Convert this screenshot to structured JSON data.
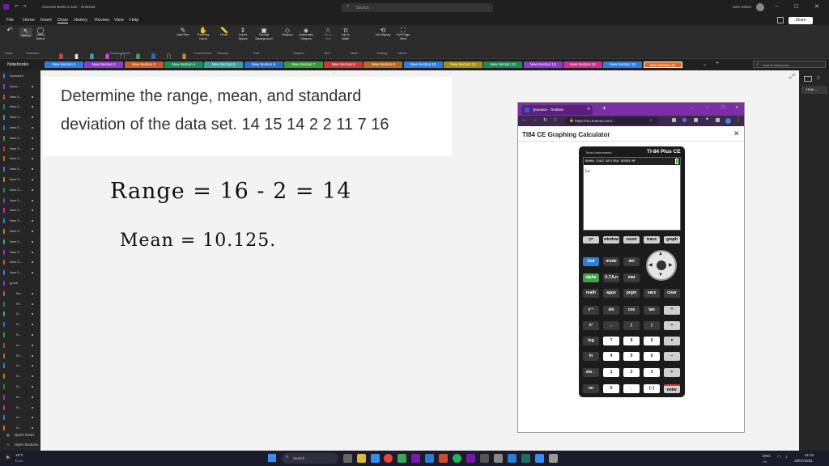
{
  "titlebar": {
    "title": "Onenote Berlin 6 Jahr - OneNote",
    "search_placeholder": "Search",
    "user": "Sam Kitson",
    "share": "Share"
  },
  "menu": [
    "File",
    "Home",
    "Insert",
    "Draw",
    "History",
    "Review",
    "View",
    "Help"
  ],
  "ribbon": {
    "undo": "Undo",
    "select": "Select",
    "lasso": "Lasso Select",
    "add_pen": "Add Pen",
    "panning": "Panning Hand",
    "ruler": "Ruler",
    "insert_space": "Insert Space",
    "format_bg": "Format Background",
    "shapes": "Shapes",
    "auto_shapes": "Automatic Shapes",
    "ink_to_text": "Ink to Text",
    "ink_to_math": "Ink to Math",
    "ink_replay": "Ink Replay",
    "full_page": "Full Page View",
    "groups": [
      "Undo",
      "Selection",
      "Drawing Tools",
      "Insert Mode",
      "Stencils",
      "Edit",
      "Shapes",
      "Text",
      "Math",
      "Replay",
      "Mode"
    ]
  },
  "pens": [
    "#d33",
    "#e6e6e6",
    "#3ad",
    "#e3e",
    "#222",
    "#3b3",
    "#26c",
    "#333",
    "#e80"
  ],
  "section_tabs": [
    {
      "label": "New Section 1",
      "color": "#2f7de1"
    },
    {
      "label": "New Section 2",
      "color": "#8a3dc9"
    },
    {
      "label": "New Section 3",
      "color": "#c75b2a"
    },
    {
      "label": "New Section 4",
      "color": "#1d8a57"
    },
    {
      "label": "New Section 5",
      "color": "#3aa0a0"
    },
    {
      "label": "New Section 6",
      "color": "#2f6fc9"
    },
    {
      "label": "New Section 7",
      "color": "#3a9a3a"
    },
    {
      "label": "New Section 8",
      "color": "#c93a3a"
    },
    {
      "label": "New Section 9",
      "color": "#b36b24"
    },
    {
      "label": "New Section 10",
      "color": "#2f7de1"
    },
    {
      "label": "New Section 11",
      "color": "#a88b12"
    },
    {
      "label": "New Section 12",
      "color": "#1d8a57"
    },
    {
      "label": "New Section 13",
      "color": "#8a3dc9"
    },
    {
      "label": "New Section 14",
      "color": "#c9328c"
    },
    {
      "label": "New Section 15",
      "color": "#2f7de1"
    },
    {
      "label": "New Section 32",
      "color": "#e06a1d"
    }
  ],
  "notebook_search": "Search Notebooks",
  "sidebar": {
    "header": "Notebooks",
    "items": [
      "Sprachen",
      "Ques...",
      "New S...",
      "New S...",
      "New S...",
      "New S...",
      "New S...",
      "New S...",
      "New S...",
      "New S...",
      "New S...",
      "New S...",
      "New S...",
      "New S...",
      "New S...",
      "New S...",
      "New S...",
      "New S...",
      "New S...",
      "New S...",
      "grace",
      "Ne...",
      "Fil...",
      "N...",
      "N...",
      "N...",
      "N...",
      "Fil...",
      "N...",
      "N...",
      "N...",
      "N...",
      "N...",
      "N...",
      "N..."
    ],
    "quick_notes": "Quick Notes",
    "open_sections": "Open Sections"
  },
  "question": {
    "line1": "Determine the range, mean, and standard",
    "line2": "deviation of the data set. 14 15 14 2 2 11 7 16"
  },
  "handwriting": {
    "range": "Range  = 16 - 2 = 14",
    "mean": "Mean   = 10.125."
  },
  "right_pane": {
    "page": "How ..."
  },
  "browser": {
    "tab": "Question - TestNav",
    "url": "https://mu.testnav.com/...",
    "heading": "TI84 CE Graphing Calculator",
    "close": "✕"
  },
  "calculator": {
    "brand": "Texas Instruments",
    "model": "TI-84 Plus CE",
    "status": "NORMAL FLOAT AUTO REAL DEGREE MP",
    "screen_text": "Ls",
    "rows": [
      [
        "y=",
        "window",
        "zoom",
        "trace",
        "graph"
      ],
      [
        "2nd",
        "mode",
        "del"
      ],
      [
        "alpha",
        "X,T,θ,n",
        "stat"
      ],
      [
        "math",
        "apps",
        "prgm",
        "vars",
        "clear"
      ],
      [
        "x⁻¹",
        "sin",
        "cos",
        "tan",
        "^"
      ],
      [
        "x²",
        ",",
        "(",
        ")",
        "÷"
      ],
      [
        "log",
        "7",
        "8",
        "9",
        "×"
      ],
      [
        "ln",
        "4",
        "5",
        "6",
        "−"
      ],
      [
        "sto→",
        "1",
        "2",
        "3",
        "+"
      ],
      [
        "on",
        "0",
        ".",
        "(−)",
        "enter"
      ]
    ]
  },
  "taskbar": {
    "weather": "18°C",
    "weather_sub": "Even",
    "search": "Search",
    "time": "01:02",
    "date": "29/07/2023",
    "lang": "ENG",
    "lang2": "UK"
  }
}
